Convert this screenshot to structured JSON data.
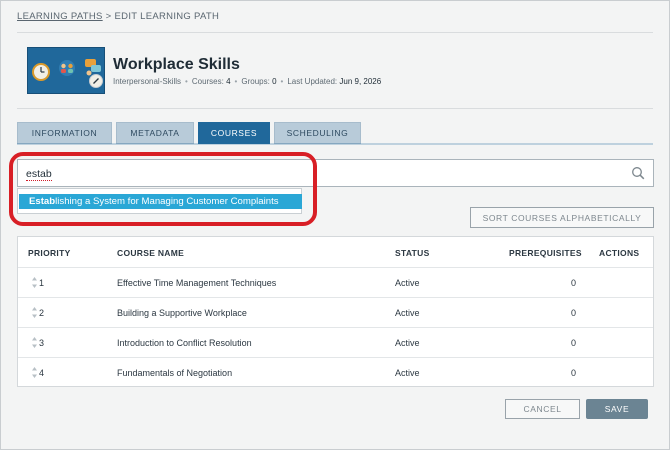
{
  "breadcrumb": {
    "link": "LEARNING PATHS",
    "separator": ">",
    "current": "EDIT LEARNING PATH"
  },
  "header": {
    "title": "Workplace Skills",
    "category": "Interpersonal-Skills",
    "courses_label": "Courses:",
    "courses_value": "4",
    "groups_label": "Groups:",
    "groups_value": "0",
    "updated_label": "Last Updated:",
    "updated_value": "Jun 9, 2026"
  },
  "tabs": [
    {
      "label": "INFORMATION",
      "active": false
    },
    {
      "label": "METADATA",
      "active": false
    },
    {
      "label": "COURSES",
      "active": true
    },
    {
      "label": "SCHEDULING",
      "active": false
    }
  ],
  "search": {
    "value": "estab",
    "icon": "search-icon"
  },
  "suggestion": {
    "match": "Estab",
    "rest": "lishing a System for Managing Customer Complaints"
  },
  "sort_button": "SORT COURSES ALPHABETICALLY",
  "table": {
    "headers": {
      "priority": "PRIORITY",
      "name": "COURSE NAME",
      "status": "STATUS",
      "prereq": "PREREQUISITES",
      "actions": "ACTIONS"
    },
    "rows": [
      {
        "priority": "1",
        "name": "Effective Time Management Techniques",
        "status": "Active",
        "prereq": "0"
      },
      {
        "priority": "2",
        "name": "Building a Supportive Workplace",
        "status": "Active",
        "prereq": "0"
      },
      {
        "priority": "3",
        "name": "Introduction to Conflict Resolution",
        "status": "Active",
        "prereq": "0"
      },
      {
        "priority": "4",
        "name": "Fundamentals of Negotiation",
        "status": "Active",
        "prereq": "0"
      }
    ]
  },
  "footer": {
    "cancel": "CANCEL",
    "save": "SAVE"
  },
  "colors": {
    "accent": "#20689b",
    "highlight": "#d81f26",
    "suggestion": "#2aa7d6",
    "save": "#6b8493"
  }
}
